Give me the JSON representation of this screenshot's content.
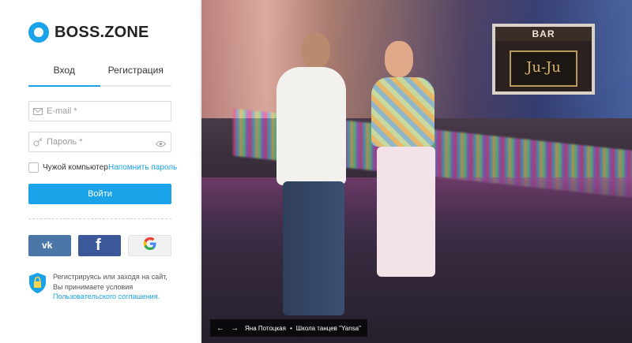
{
  "brand": {
    "name": "BOSS.ZONE",
    "accent": "#1aa3e8"
  },
  "tabs": [
    {
      "label": "Вход",
      "active": true
    },
    {
      "label": "Регистрация",
      "active": false
    }
  ],
  "form": {
    "email_placeholder": "E-mail *",
    "email_value": "",
    "password_placeholder": "Пароль *",
    "password_value": "",
    "remember_label": "Чужой компьютер",
    "remember_checked": false,
    "forgot_label": "Напомнить пароль",
    "submit_label": "Войти"
  },
  "social": [
    {
      "name": "vk",
      "label": "vk",
      "color": "#4a76a8"
    },
    {
      "name": "facebook",
      "label": "f",
      "color": "#3b5998"
    },
    {
      "name": "google",
      "label": "G",
      "color": "#f1f1f1"
    }
  ],
  "notice": {
    "text": "Регистрируясь или заходя на сайт, Вы принимаете условия ",
    "link_label": "Пользовательского соглашения."
  },
  "photo": {
    "bar_top": "BAR",
    "bar_sign": "Ju-Ju"
  },
  "caption": {
    "author": "Яна Потоцкая",
    "title": "Школа танцев \"Yansa\""
  }
}
